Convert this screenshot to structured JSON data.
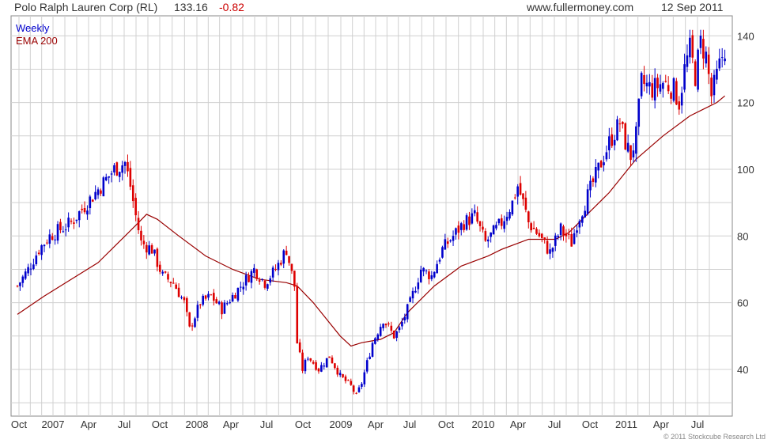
{
  "header": {
    "title": "Polo Ralph Lauren Corp (RL)",
    "price": "133.16",
    "change": "-0.82",
    "site": "www.fullermoney.com",
    "date": "12 Sep 2011"
  },
  "legend": {
    "weekly": "Weekly",
    "ema": "EMA 200"
  },
  "copyright": "© 2011 Stockcube Research Ltd",
  "colors": {
    "up": "#0000cc",
    "down": "#dd0000",
    "ema": "#990000",
    "grid": "#d0d0d0",
    "change": "#cc0000"
  },
  "chart_data": {
    "type": "candlestick",
    "interval": "Weekly",
    "x_tick_labels": [
      "Oct",
      "2007",
      "Apr",
      "Jul",
      "Oct",
      "2008",
      "Apr",
      "Jul",
      "Oct",
      "2009",
      "Apr",
      "Jul",
      "Oct",
      "2010",
      "Apr",
      "Jul",
      "Oct",
      "2011",
      "Apr",
      "Jul"
    ],
    "x_range": [
      "2006-10",
      "2011-09"
    ],
    "y_ticks": [
      40,
      60,
      80,
      100,
      120,
      140
    ],
    "ylim": [
      26,
      146
    ],
    "grid": true,
    "legend_position": "top-left",
    "series": [
      {
        "name": "Weekly",
        "kind": "candles",
        "close": [
          [
            0,
            65
          ],
          [
            4,
            70
          ],
          [
            8,
            76
          ],
          [
            12,
            80
          ],
          [
            16,
            82
          ],
          [
            20,
            84
          ],
          [
            24,
            88
          ],
          [
            28,
            92
          ],
          [
            32,
            96
          ],
          [
            36,
            100
          ],
          [
            40,
            102
          ],
          [
            42,
            95
          ],
          [
            44,
            86
          ],
          [
            46,
            78
          ],
          [
            50,
            76
          ],
          [
            54,
            68
          ],
          [
            58,
            66
          ],
          [
            62,
            60
          ],
          [
            64,
            52
          ],
          [
            68,
            60
          ],
          [
            72,
            62
          ],
          [
            76,
            58
          ],
          [
            80,
            62
          ],
          [
            84,
            66
          ],
          [
            88,
            70
          ],
          [
            92,
            66
          ],
          [
            96,
            70
          ],
          [
            100,
            76
          ],
          [
            103,
            65
          ],
          [
            104,
            48
          ],
          [
            106,
            40
          ],
          [
            108,
            44
          ],
          [
            112,
            40
          ],
          [
            116,
            44
          ],
          [
            120,
            38
          ],
          [
            124,
            35
          ],
          [
            126,
            32
          ],
          [
            128,
            36
          ],
          [
            132,
            48
          ],
          [
            136,
            55
          ],
          [
            140,
            50
          ],
          [
            142,
            52
          ],
          [
            146,
            60
          ],
          [
            150,
            70
          ],
          [
            154,
            68
          ],
          [
            158,
            76
          ],
          [
            162,
            80
          ],
          [
            166,
            84
          ],
          [
            170,
            86
          ],
          [
            174,
            78
          ],
          [
            176,
            80
          ],
          [
            180,
            84
          ],
          [
            184,
            90
          ],
          [
            186,
            95
          ],
          [
            188,
            90
          ],
          [
            190,
            84
          ],
          [
            194,
            80
          ],
          [
            198,
            75
          ],
          [
            202,
            82
          ],
          [
            206,
            78
          ],
          [
            208,
            84
          ],
          [
            212,
            92
          ],
          [
            216,
            100
          ],
          [
            220,
            108
          ],
          [
            224,
            114
          ],
          [
            226,
            108
          ],
          [
            228,
            104
          ],
          [
            230,
            110
          ],
          [
            232,
            126
          ],
          [
            236,
            124
          ],
          [
            240,
            126
          ],
          [
            244,
            124
          ],
          [
            246,
            120
          ],
          [
            248,
            130
          ],
          [
            250,
            136
          ],
          [
            252,
            128
          ],
          [
            254,
            138
          ],
          [
            256,
            134
          ],
          [
            258,
            122
          ],
          [
            260,
            128
          ],
          [
            262,
            134
          ],
          [
            263,
            133.16
          ]
        ]
      },
      {
        "name": "EMA 200",
        "kind": "line",
        "points": [
          [
            0,
            56.5
          ],
          [
            10,
            62
          ],
          [
            20,
            67
          ],
          [
            30,
            72
          ],
          [
            40,
            80
          ],
          [
            45,
            84
          ],
          [
            48,
            86.5
          ],
          [
            52,
            85
          ],
          [
            60,
            80
          ],
          [
            70,
            74
          ],
          [
            80,
            70
          ],
          [
            90,
            67
          ],
          [
            100,
            66
          ],
          [
            104,
            65
          ],
          [
            110,
            60
          ],
          [
            115,
            55
          ],
          [
            120,
            50
          ],
          [
            124,
            47
          ],
          [
            128,
            48
          ],
          [
            135,
            49
          ],
          [
            140,
            51
          ],
          [
            145,
            57
          ],
          [
            155,
            65
          ],
          [
            165,
            71
          ],
          [
            175,
            74
          ],
          [
            180,
            76
          ],
          [
            190,
            79
          ],
          [
            195,
            79
          ],
          [
            200,
            79
          ],
          [
            205,
            81
          ],
          [
            210,
            85
          ],
          [
            220,
            93
          ],
          [
            230,
            103
          ],
          [
            240,
            110
          ],
          [
            250,
            116
          ],
          [
            255,
            118
          ],
          [
            260,
            120
          ],
          [
            263,
            122
          ]
        ]
      }
    ]
  }
}
